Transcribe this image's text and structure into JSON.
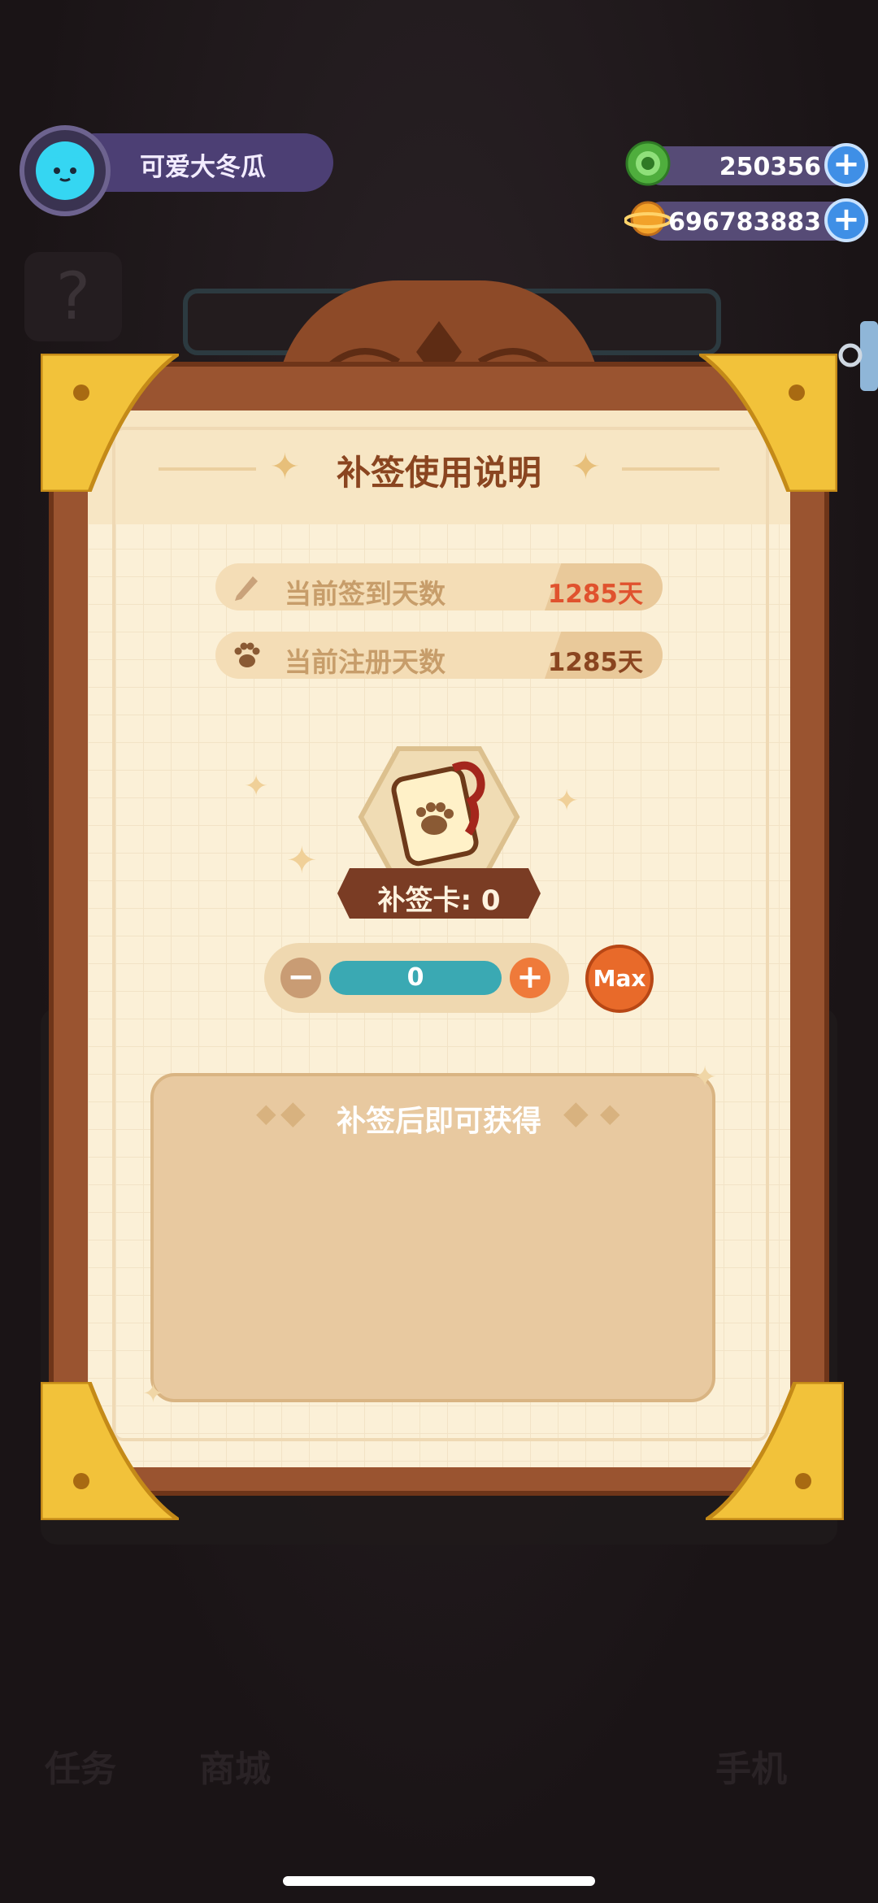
{
  "player": {
    "name": "可爱大冬瓜"
  },
  "currencies": [
    {
      "name": "green-coin",
      "value": "250356",
      "color": "#5fbf4a"
    },
    {
      "name": "planet-coin",
      "value": "696783883",
      "color": "#f2a22a"
    }
  ],
  "dialog": {
    "title": "补签使用说明",
    "rows": [
      {
        "label": "当前签到天数",
        "value": "1285天",
        "value_color": "#e0522e",
        "icon": "pencil-icon"
      },
      {
        "label": "当前注册天数",
        "value": "1285天",
        "value_color": "#8a4520",
        "icon": "paw-icon"
      }
    ],
    "card_label": "补签卡: 0",
    "quantity": "0",
    "max_label": "Max",
    "rewards_title": "补签后即可获得"
  },
  "background_nav": {
    "task_label": "任务",
    "shop_label": "商城",
    "phone_label": "手机"
  }
}
